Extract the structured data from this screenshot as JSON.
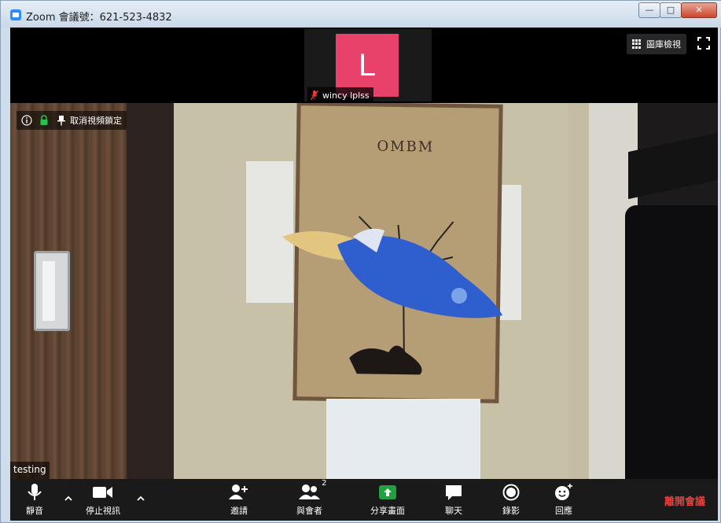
{
  "window": {
    "title": "Zoom 會議號：621-523-4832",
    "controls": [
      "minimize",
      "maximize",
      "close"
    ]
  },
  "top_bar": {
    "thumbnail": {
      "avatar_letter": "L",
      "avatar_color": "#e8426a",
      "participant_name": "wincy lplss",
      "muted": true
    },
    "gallery_view_label": "圖庫檢視",
    "fullscreen_icon": "fullscreen-icon"
  },
  "video": {
    "info_icon": "info-icon",
    "security_icon": "lock-icon",
    "pin_label": "取消視頻鎖定",
    "speaker_name": "testing",
    "board_logo": "OMBM"
  },
  "toolbar": {
    "mute_label": "靜音",
    "stop_video_label": "停止視訊",
    "invite_label": "邀請",
    "participants_label": "與會者",
    "participants_count": "2",
    "share_label": "分享畫面",
    "chat_label": "聊天",
    "record_label": "錄影",
    "reactions_label": "回應",
    "leave_label": "離開會議",
    "share_color": "#23a042",
    "leave_color": "#e7403c"
  }
}
